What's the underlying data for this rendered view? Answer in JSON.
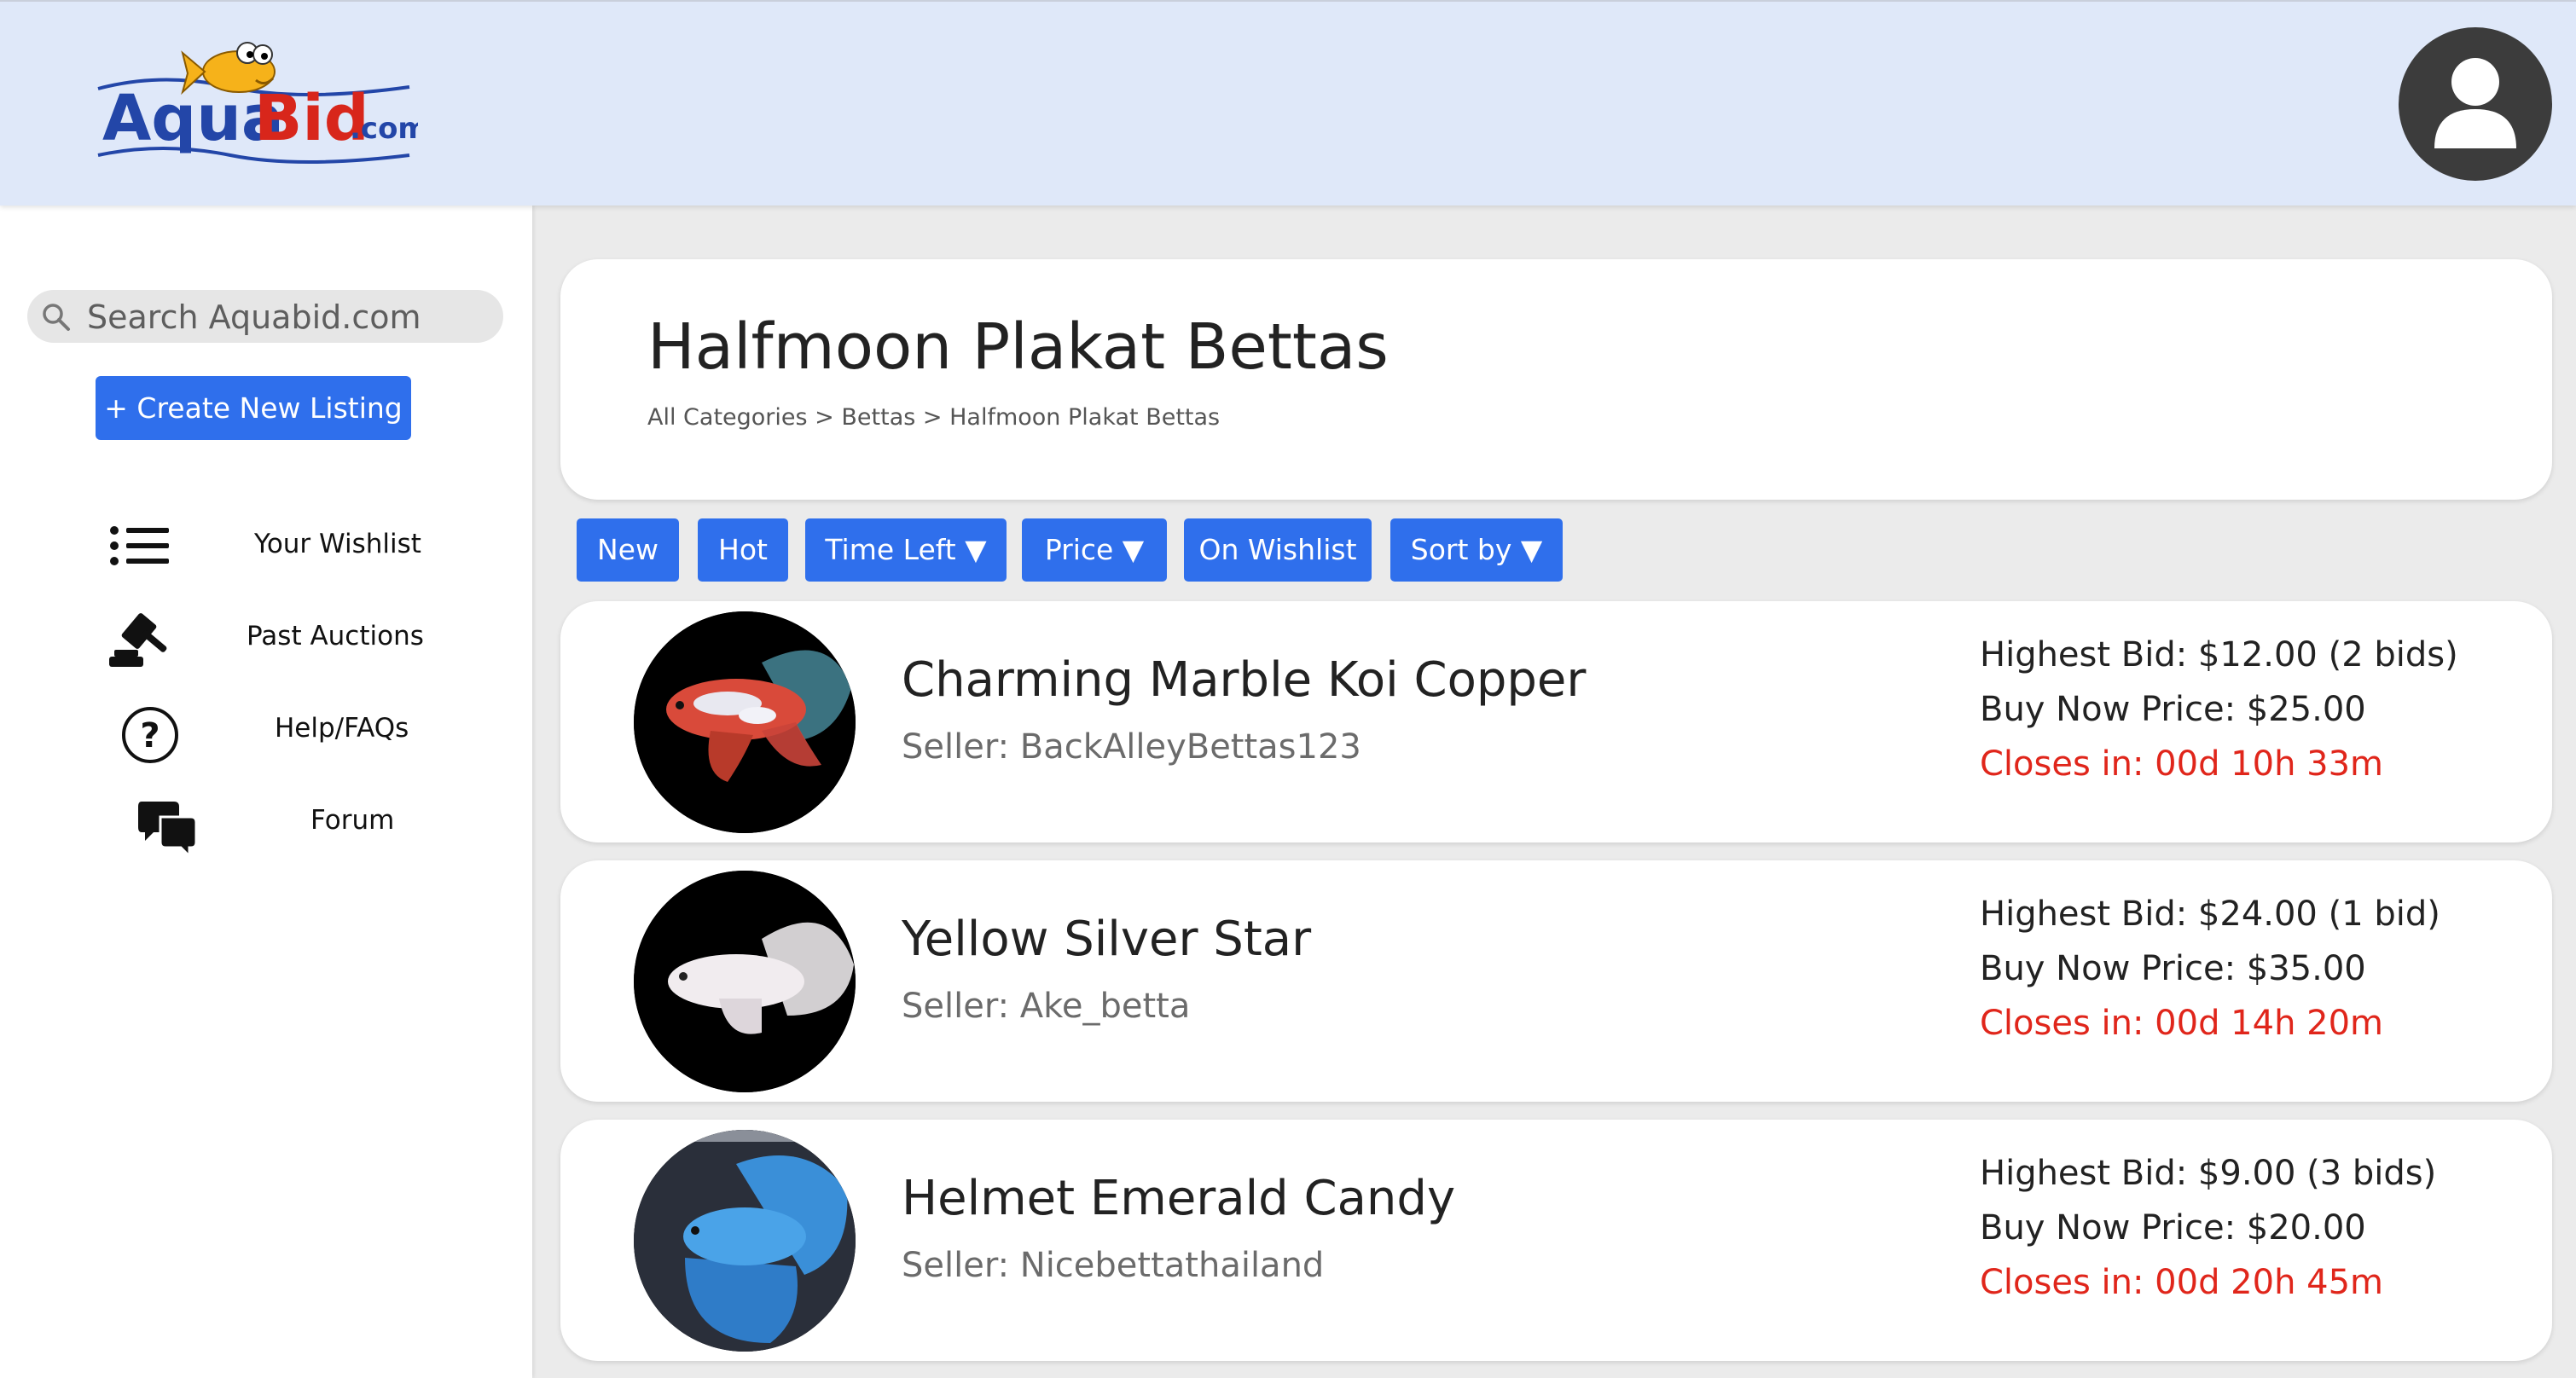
{
  "header": {
    "logo_text": "AquaBid.com",
    "logo_main": "AquaBid",
    "logo_suffix": ".com"
  },
  "sidebar": {
    "search_placeholder": "Search Aquabid.com",
    "create_label": "+ Create New Listing",
    "nav": [
      {
        "label": "Your Wishlist",
        "icon": "list-icon"
      },
      {
        "label": "Past Auctions",
        "icon": "gavel-icon"
      },
      {
        "label": "Help/FAQs",
        "icon": "question-circle-icon"
      },
      {
        "label": "Forum",
        "icon": "chat-bubbles-icon"
      }
    ]
  },
  "page": {
    "title": "Halfmoon Plakat Bettas",
    "breadcrumb": [
      "All Categories",
      "Bettas",
      "Halfmoon Plakat Bettas"
    ],
    "breadcrumb_separator": " > "
  },
  "filters": [
    "New",
    "Hot",
    "Time Left ▼",
    "Price ▼",
    "On Wishlist",
    "Sort by ▼"
  ],
  "listings": [
    {
      "name": "Charming Marble Koi Copper",
      "seller": "Seller: BackAlleyBettas123",
      "highest_bid": "Highest Bid: $12.00 (2 bids)",
      "buy_now": "Buy Now Price: $25.00",
      "closes": "Closes in: 00d 10h 33m"
    },
    {
      "name": "Yellow Silver Star",
      "seller": "Seller: Ake_betta",
      "highest_bid": "Highest Bid: $24.00 (1 bid)",
      "buy_now": "Buy Now Price: $35.00",
      "closes": "Closes in: 00d 14h 20m"
    },
    {
      "name": "Helmet Emerald Candy",
      "seller": "Seller: Nicebettathailand",
      "highest_bid": "Highest Bid: $9.00 (3 bids)",
      "buy_now": "Buy Now Price: $20.00",
      "closes": "Closes in: 00d 20h 45m"
    }
  ],
  "colors": {
    "header_bg": "#dfe8f9",
    "accent_blue": "#2f6fec",
    "closes_red": "#e0261b",
    "page_bg": "#ebebeb"
  }
}
